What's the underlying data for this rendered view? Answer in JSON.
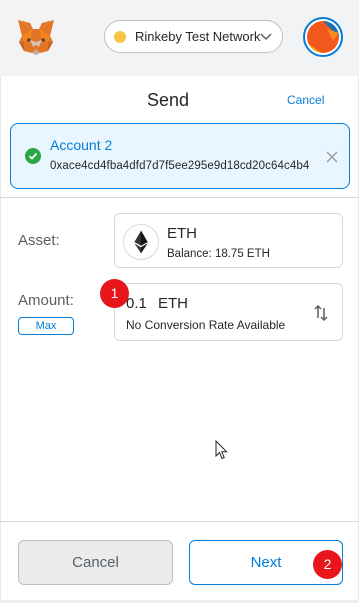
{
  "header": {
    "network_label": "Rinkeby Test Network",
    "network_color": "#f6c343",
    "icons": [
      "metamask-fox-icon",
      "chevron-down-icon",
      "account-avatar"
    ]
  },
  "page": {
    "title": "Send",
    "cancel_link": "Cancel"
  },
  "account": {
    "name": "Account 2",
    "address": "0xace4cd4fba4dfd7d7f5ee295e9d18cd20c64c4b4",
    "icons": [
      "check-circle-icon",
      "close-icon"
    ]
  },
  "form": {
    "asset_label": "Asset:",
    "asset_symbol": "ETH",
    "asset_balance": "Balance: 18.75 ETH",
    "amount_label": "Amount:",
    "max_label": "Max",
    "amount_value": "0.1",
    "amount_unit": "ETH",
    "conversion_text": "No Conversion Rate Available"
  },
  "annotations": {
    "badge_1": "1",
    "badge_2": "2",
    "badge_color": "#e8151b"
  },
  "footer": {
    "cancel_label": "Cancel",
    "next_label": "Next"
  },
  "colors": {
    "accent": "#037dd6",
    "success": "#28a745"
  }
}
